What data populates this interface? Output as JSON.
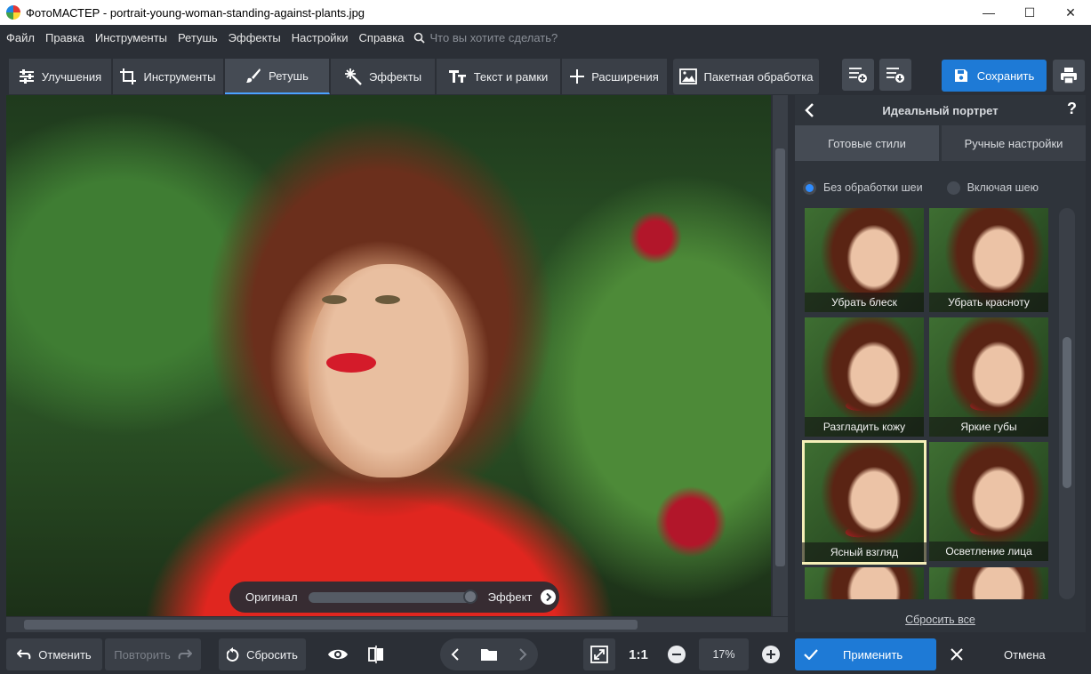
{
  "window": {
    "title": "ФотоМАСТЕР - portrait-young-woman-standing-against-plants.jpg",
    "minimize": "—",
    "maximize": "☐",
    "close": "✕"
  },
  "menu": {
    "items": [
      "Файл",
      "Правка",
      "Инструменты",
      "Ретушь",
      "Эффекты",
      "Настройки",
      "Справка"
    ],
    "search_placeholder": "Что вы хотите сделать?"
  },
  "tabs": [
    {
      "label": "Улучшения",
      "icon": "sliders-icon",
      "active": false
    },
    {
      "label": "Инструменты",
      "icon": "crop-icon",
      "active": false
    },
    {
      "label": "Ретушь",
      "icon": "brush-icon",
      "active": true
    },
    {
      "label": "Эффекты",
      "icon": "sparkle-icon",
      "active": false
    },
    {
      "label": "Текст и рамки",
      "icon": "text-icon",
      "active": false
    },
    {
      "label": "Расширения",
      "icon": "plus-icon",
      "active": false
    }
  ],
  "toolbar": {
    "batch_label": "Пакетная обработка",
    "save_label": "Сохранить"
  },
  "compare": {
    "original_label": "Оригинал",
    "effect_label": "Эффект",
    "position": 1.0
  },
  "panel": {
    "title": "Идеальный портрет",
    "help": "?",
    "tabs": [
      "Готовые стили",
      "Ручные настройки"
    ],
    "active_tab": 0,
    "radios": [
      {
        "label": "Без обработки шеи",
        "checked": true
      },
      {
        "label": "Включая шею",
        "checked": false
      }
    ],
    "presets": [
      {
        "label": "Убрать блеск",
        "selected": false
      },
      {
        "label": "Убрать красноту",
        "selected": false
      },
      {
        "label": "Разгладить кожу",
        "selected": false
      },
      {
        "label": "Яркие губы",
        "selected": false
      },
      {
        "label": "Ясный взгляд",
        "selected": true
      },
      {
        "label": "Осветление лица",
        "selected": false
      },
      {
        "label": "",
        "selected": false
      },
      {
        "label": "",
        "selected": false
      }
    ],
    "reset_all": "Сбросить все"
  },
  "bottom": {
    "undo_label": "Отменить",
    "redo_label": "Повторить",
    "reset_label": "Сбросить",
    "ratio_label": "1:1",
    "zoom_value": "17%",
    "apply_label": "Применить",
    "cancel_label": "Отмена"
  },
  "colors": {
    "accent": "#1e7ad6",
    "selected_outline": "#f5efb8",
    "radio_on": "#2f8cff"
  }
}
